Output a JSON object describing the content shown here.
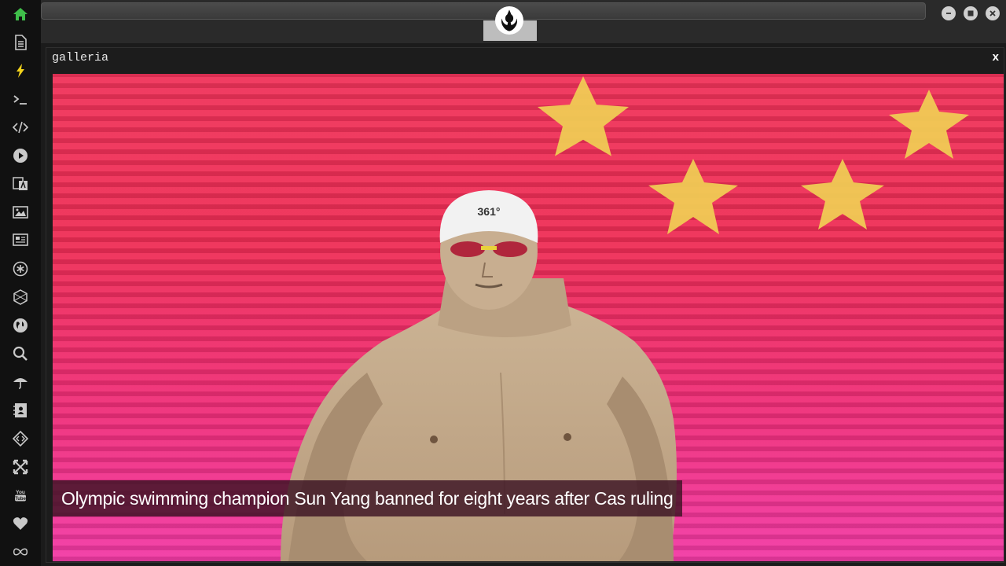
{
  "window": {
    "buttons": [
      "minimize",
      "maximize",
      "close"
    ]
  },
  "sidebar": {
    "items": [
      {
        "icon": "home-icon",
        "active": true
      },
      {
        "icon": "document-icon"
      },
      {
        "icon": "lightning-icon"
      },
      {
        "icon": "terminal-icon"
      },
      {
        "icon": "code-icon"
      },
      {
        "icon": "play-icon"
      },
      {
        "icon": "translate-icon"
      },
      {
        "icon": "image-icon"
      },
      {
        "icon": "newspaper-icon"
      },
      {
        "icon": "asterisk-icon"
      },
      {
        "icon": "hexagon-icon"
      },
      {
        "icon": "globe-icon"
      },
      {
        "icon": "search-icon"
      },
      {
        "icon": "umbrella-icon"
      },
      {
        "icon": "contacts-icon"
      },
      {
        "icon": "tag-code-icon"
      },
      {
        "icon": "expand-icon"
      },
      {
        "icon": "youtube-icon"
      },
      {
        "icon": "heart-icon"
      },
      {
        "icon": "infinity-icon"
      }
    ]
  },
  "topbar": {
    "logo_icon": "rebel-alliance-icon"
  },
  "galleria": {
    "title": "galleria",
    "close_label": "x",
    "caption": "Olympic swimming champion Sun Yang banned for eight years after Cas ruling",
    "image_icon": "swimmer-photo"
  },
  "colors": {
    "accent_green": "#3fbf4a",
    "accent_yellow": "#f2d21b",
    "sidebar_icon": "#c9c9c9"
  }
}
